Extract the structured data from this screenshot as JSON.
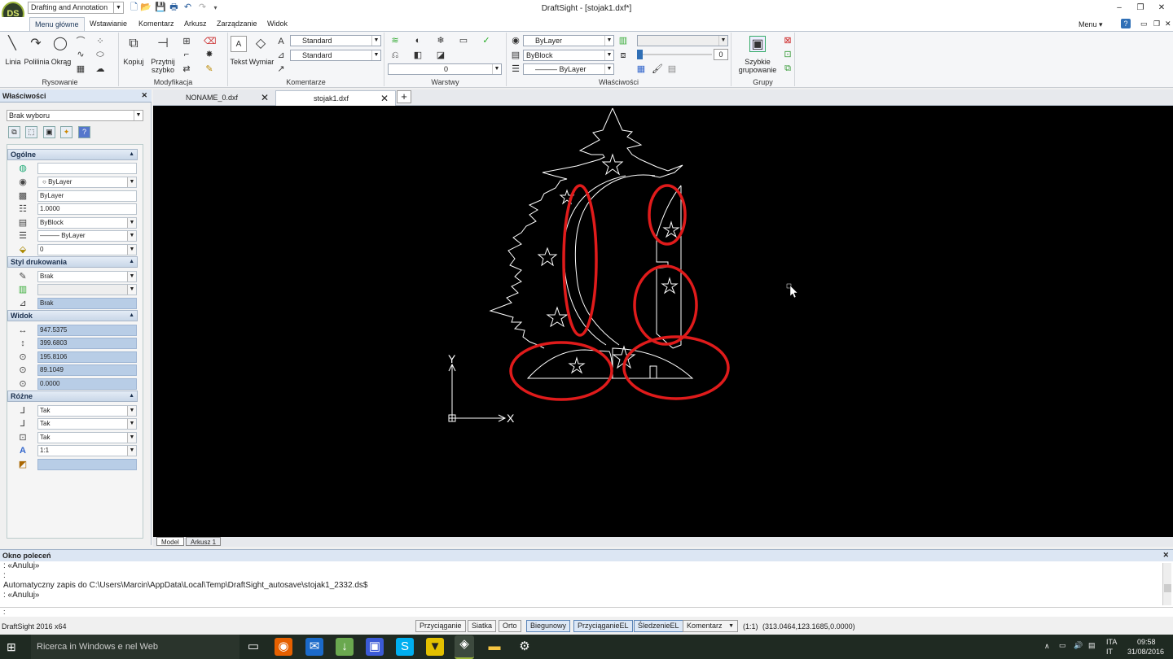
{
  "window": {
    "title": "DraftSight - [stojak1.dxf*]",
    "logo": "DS",
    "workspace": "Drafting and Annotation",
    "menu_label": "Menu ▾",
    "help_label": "?"
  },
  "ribbon_tabs": [
    "Menu główne",
    "Wstawianie",
    "Komentarz",
    "Arkusz",
    "Zarządzanie",
    "Widok"
  ],
  "ribbon": {
    "draw": {
      "label": "Rysowanie",
      "linia": "Linia",
      "polilinia": "Polilinia",
      "okrag": "Okrąg"
    },
    "modify": {
      "label": "Modyfikacja",
      "kopiuj": "Kopiuj",
      "przytnij": "Przytnij",
      "szybko": "szybko"
    },
    "annot": {
      "label": "Komentarze",
      "tekst": "Tekst",
      "wymiar": "Wymiar",
      "style1": "Standard",
      "style2": "Standard"
    },
    "layers": {
      "label": "Warstwy",
      "current": "0"
    },
    "props": {
      "label": "Właściwości",
      "color": "ByLayer",
      "linestyle": "ByBlock",
      "lineweight": "——— ByLayer",
      "transparency": "0"
    },
    "groups": {
      "label": "Grupy",
      "szybkie": "Szybkie",
      "grupowanie": "grupowanie"
    }
  },
  "panel": {
    "title": "Właściwości",
    "selection": "Brak wyboru",
    "sections": {
      "ogolne": "Ogólne",
      "styl": "Styl drukowania",
      "widok": "Widok",
      "rozne": "Różne"
    },
    "ogolne": [
      "",
      "ByLayer",
      "ByLayer",
      "1.0000",
      "ByBlock",
      "——— ByLayer",
      "0"
    ],
    "styl": [
      "Brak",
      "",
      "Brak"
    ],
    "widok": [
      "947.5375",
      "399.6803",
      "195.8106",
      "89.1049",
      "0.0000"
    ],
    "rozne": [
      "Tak",
      "Tak",
      "Tak",
      "1:1",
      ""
    ]
  },
  "doc_tabs": [
    "NONAME_0.dxf",
    "stojak1.dxf"
  ],
  "layout_tabs": [
    "Model",
    "Arkusz 1"
  ],
  "axes": {
    "x": "X",
    "y": "Y"
  },
  "command": {
    "title": "Okno poleceń",
    "lines": [
      ": «Anuluj»",
      ":",
      "Automatyczny zapis do C:\\Users\\Marcin\\AppData\\Local\\Temp\\DraftSight_autosave\\stojak1_2332.ds$",
      ": «Anuluj»"
    ],
    "prompt": ":"
  },
  "status": {
    "product": "DraftSight 2016 x64",
    "buttons": [
      "Przyciąganie",
      "Siatka",
      "Orto",
      "Biegunowy",
      "PrzyciąganieEL",
      "ŚledzenieEL"
    ],
    "annot": "Komentarz",
    "scale": "(1:1)",
    "coords": "(313.0464,123.1685,0.0000)"
  },
  "taskbar": {
    "search": "Ricerca in Windows e nel Web",
    "lang1": "ITA",
    "lang2": "IT",
    "time": "09:58",
    "date": "31/08/2016"
  },
  "colors": {
    "accent": "#2f6fb6",
    "highlight": "#e01b1b",
    "canvas": "#000000"
  }
}
